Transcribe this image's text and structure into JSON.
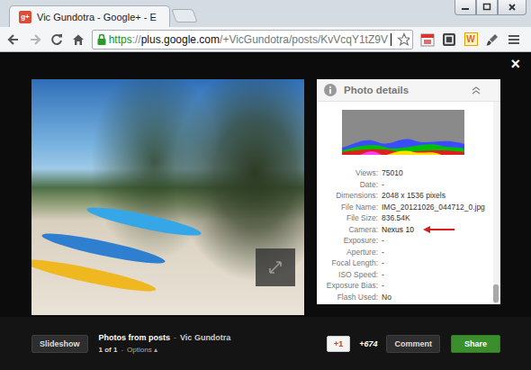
{
  "window": {
    "title": "Vic Gundotra - Google+ - E",
    "favicon": "g+"
  },
  "toolbar": {
    "url": {
      "scheme": "https",
      "separator": "://",
      "host": "plus.google.com",
      "path": "/+VicGundotra/posts/KvVcqY1tZ9V"
    },
    "forward_disabled": true,
    "extension_label": "W"
  },
  "lightbox": {
    "close": "×"
  },
  "details": {
    "title": "Photo details",
    "expanded": true,
    "rows": [
      {
        "label": "Views:",
        "value": "75010",
        "marked": false
      },
      {
        "label": "Date:",
        "value": "-",
        "marked": false
      },
      {
        "label": "Dimensions:",
        "value": "2048 x 1536 pixels",
        "marked": false
      },
      {
        "label": "File Name:",
        "value": "IMG_20121026_044712_0.jpg",
        "marked": false
      },
      {
        "label": "File Size:",
        "value": "836.54K",
        "marked": false
      },
      {
        "label": "Camera:",
        "value": "Nexus 10",
        "marked": true
      },
      {
        "label": "Exposure:",
        "value": "-",
        "marked": false
      },
      {
        "label": "Aperture:",
        "value": "-",
        "marked": false
      },
      {
        "label": "Focal Length:",
        "value": "-",
        "marked": false
      },
      {
        "label": "ISO Speed:",
        "value": "-",
        "marked": false
      },
      {
        "label": "Exposure Bias:",
        "value": "-",
        "marked": false
      },
      {
        "label": "Flash Used:",
        "value": "No",
        "marked": false
      }
    ]
  },
  "footer": {
    "slideshow": "Slideshow",
    "album": "Photos from posts",
    "separator": "-",
    "owner": "Vic Gundotra",
    "position": "1 of 1",
    "options": "Options",
    "options_arrow": "▴",
    "plus_one": "+1",
    "plus_count": "+674",
    "comment": "Comment",
    "share": "Share"
  }
}
